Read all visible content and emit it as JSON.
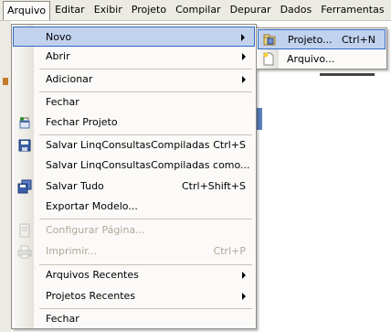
{
  "menubar": {
    "items": [
      "Arquivo",
      "Editar",
      "Exibir",
      "Projeto",
      "Compilar",
      "Depurar",
      "Dados",
      "Ferramentas"
    ]
  },
  "file_menu": {
    "novo": "Novo",
    "abrir": "Abrir",
    "adicionar": "Adicionar",
    "fechar": "Fechar",
    "fechar_projeto": "Fechar Projeto",
    "salvar": "Salvar LinqConsultasCompiladas",
    "salvar_sc": "Ctrl+S",
    "salvar_como": "Salvar LinqConsultasCompiladas como...",
    "salvar_tudo": "Salvar Tudo",
    "salvar_tudo_sc": "Ctrl+Shift+S",
    "exportar": "Exportar Modelo...",
    "configurar": "Configurar Página...",
    "imprimir": "Imprimir...",
    "imprimir_sc": "Ctrl+P",
    "arquivos_recentes": "Arquivos Recentes",
    "projetos_recentes": "Projetos Recentes",
    "fechar2": "Fechar"
  },
  "new_submenu": {
    "projeto": "Projeto...",
    "projeto_sc": "Ctrl+N",
    "arquivo": "Arquivo..."
  },
  "icons": {
    "fechar_projeto": "close-project-icon",
    "salvar": "save-icon",
    "salvar_tudo": "save-all-icon",
    "configurar": "page-setup-icon",
    "imprimir": "print-icon",
    "projeto": "new-project-icon",
    "arquivo": "new-file-icon"
  },
  "colors": {
    "highlight": "#c1d2ee",
    "highlight_border": "#316ac5",
    "menu_bg": "#fbfaf8",
    "disabled": "#aca899"
  }
}
